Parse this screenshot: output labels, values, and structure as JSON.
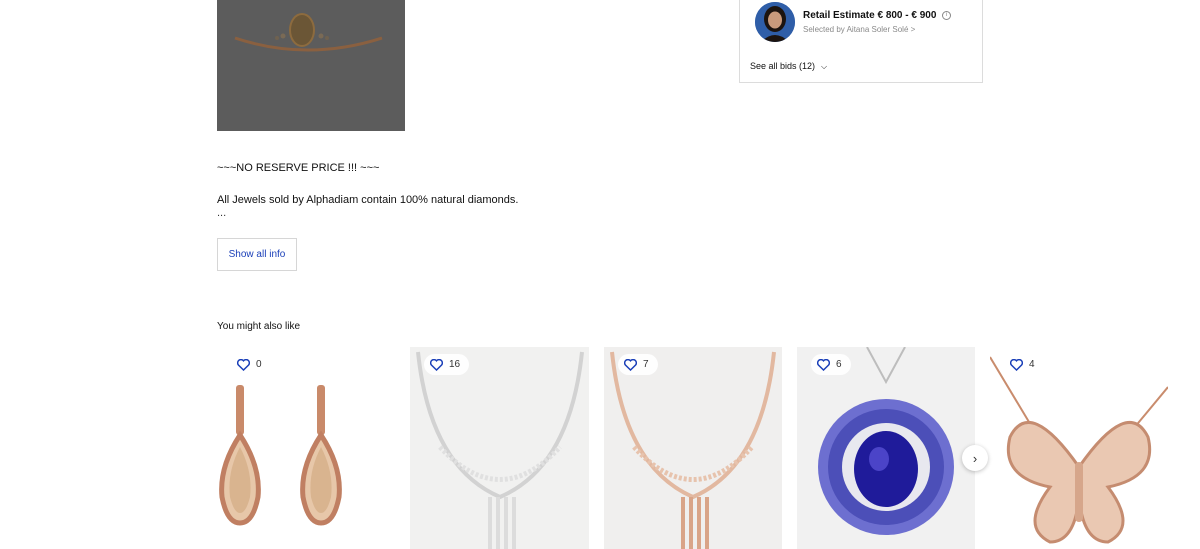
{
  "description": {
    "line1": "~~~NO RESERVE PRICE !!! ~~~",
    "line2": "All Jewels sold by Alphadiam contain 100% natural diamonds.",
    "ellipsis": "...",
    "show_all_label": "Show all info"
  },
  "bid_panel": {
    "estimate_label": "Retail Estimate € 800 - € 900",
    "info_icon": "info-icon",
    "selected_by": "Selected by Aitana Soler Solé >",
    "see_all_bids": "See all bids (12)",
    "chevron": "chevron-down-icon"
  },
  "recommendations": {
    "title": "You might also like",
    "items": [
      {
        "favorites": "0",
        "subject": "rose gold pear diamond drop earrings"
      },
      {
        "favorites": "16",
        "subject": "white gold diamond necklace"
      },
      {
        "favorites": "7",
        "subject": "rose gold diamond necklace"
      },
      {
        "favorites": "6",
        "subject": "tanzanite pendant"
      },
      {
        "favorites": "4",
        "subject": "rose gold butterfly diamond necklace"
      }
    ],
    "next_arrow": "chevron-right-icon"
  },
  "colors": {
    "link_blue": "#1a3fb8",
    "heart_blue": "#1a3fb8"
  }
}
